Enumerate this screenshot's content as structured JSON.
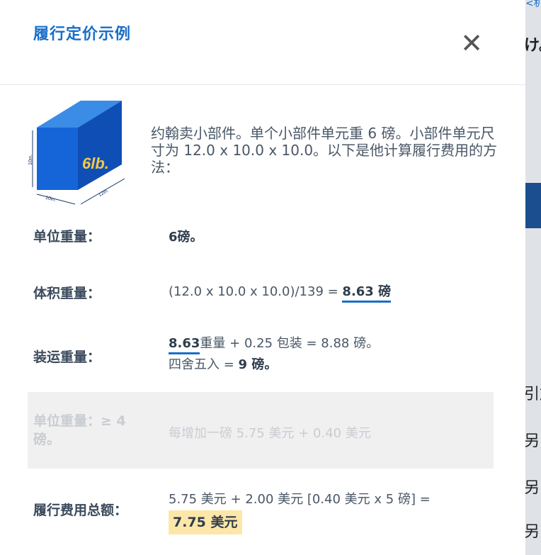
{
  "background_page": {
    "top_link": "<机",
    "fragments": [
      "け。",
      "引加",
      "另",
      "另",
      "另"
    ]
  },
  "modal": {
    "title": "履行定价示例",
    "close_symbol": "✕",
    "cube": {
      "weight_label": "6lb.",
      "dim_side": "10in.",
      "dim_front": "10in.",
      "dim_right": "12in."
    },
    "intro": "约翰卖小部件。单个小部件单元重 6 磅。小部件单元尺寸为 12.0 x 10.0 x 10.0。以下是他计算履行费用的方法：",
    "unit_weight": {
      "label": "单位重量：",
      "value": "6磅。"
    },
    "dim_weight": {
      "label": "体积重量：",
      "formula": "(12.0 x 10.0 x 10.0)/139 = ",
      "result": "8.63 磅"
    },
    "shipping_weight": {
      "label": "装运重量：",
      "value_bold": "8.63",
      "line1_rest": "重量 + 0.25 包装 = 8.88 磅。",
      "line2_prefix": "四舍五入 = ",
      "line2_bold": "9 磅。"
    },
    "dim_unit_row": {
      "label": "单位重量：≥ 4 磅。",
      "value": "每增加一磅 5.75 美元 + 0.40 美元"
    },
    "total": {
      "label": "履行费用总额：",
      "formula": "5.75 美元 + 2.00 美元 [0.40 美元 x 5 磅] =",
      "result": "7.75 美元"
    }
  },
  "colors": {
    "accent": "#1a6fc9",
    "highlight": "#fde7a8",
    "cube_front": "#1565d8",
    "cube_top": "#3a8ce6",
    "cube_side": "#0f4fb5"
  }
}
